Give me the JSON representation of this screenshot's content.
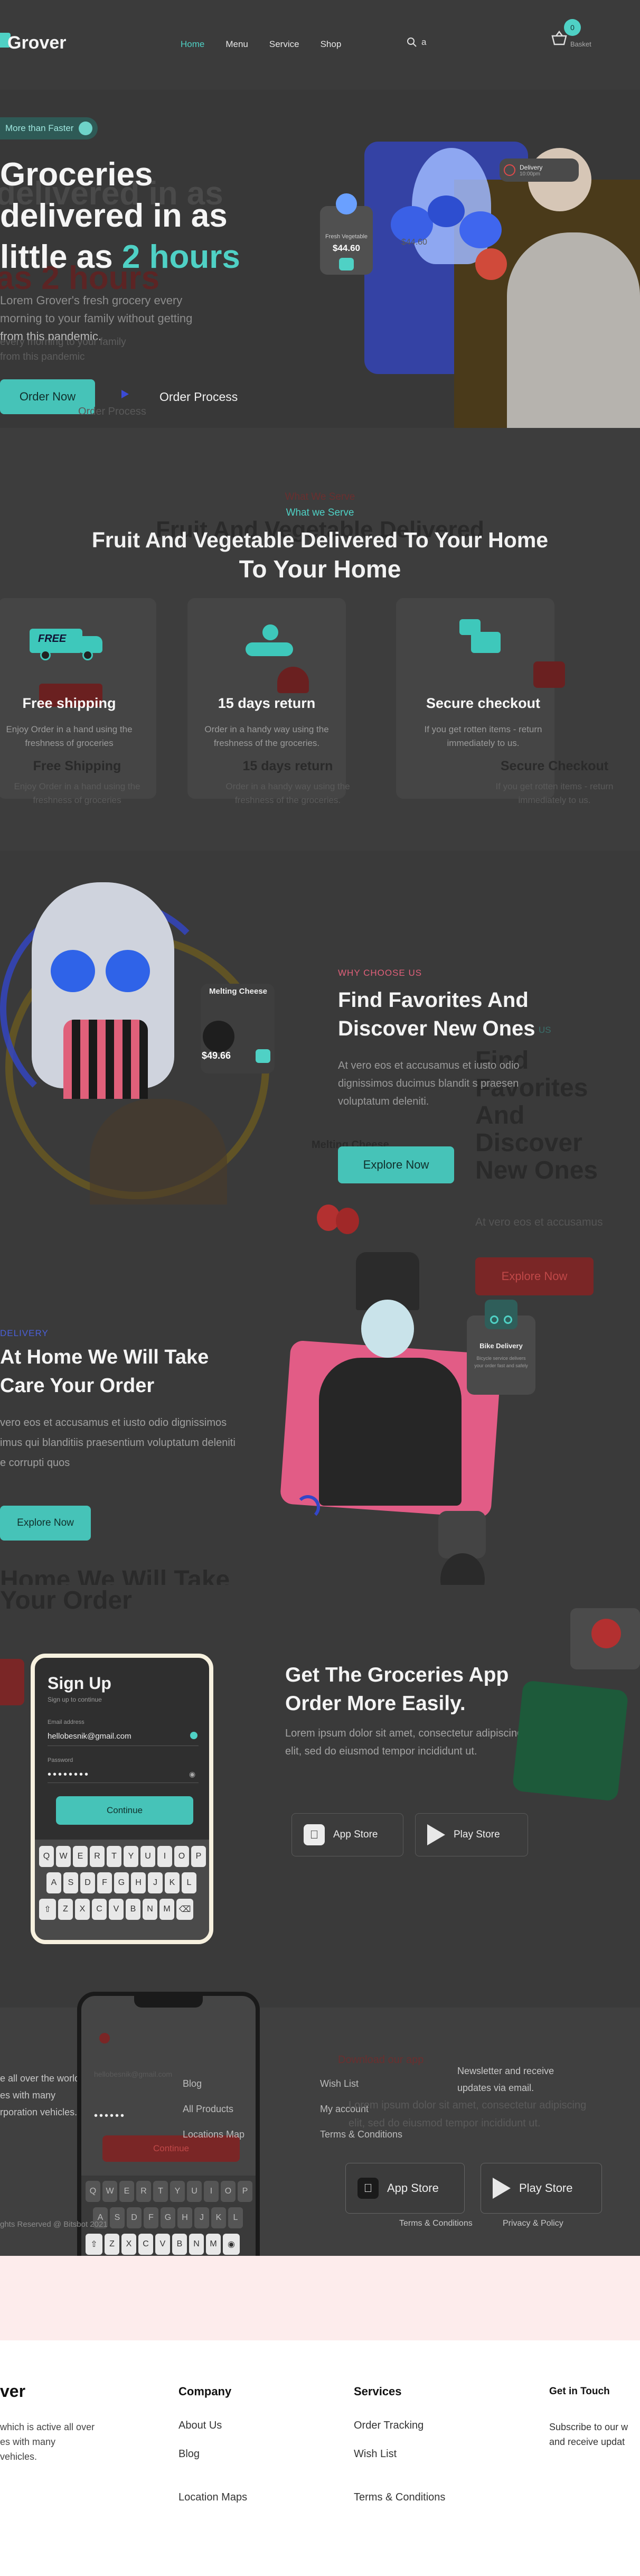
{
  "header": {
    "brand": "Grover",
    "nav": [
      "Home",
      "Menu",
      "Service",
      "Shop"
    ],
    "search_value": "a",
    "cart_count": "0",
    "cart_label": "Basket"
  },
  "hero": {
    "badge": "More than Faster",
    "title_lines": [
      "Groceries",
      "delivered in as",
      "little as"
    ],
    "title_highlight": "2 hours",
    "ghost_line": "as 2 hours",
    "desc_lines": [
      "Lorem Grover's fresh grocery every",
      "morning to your family without getting",
      "from this pandemic."
    ],
    "desc_ghost_lines": [
      "every morning to your family",
      "from this pandemic"
    ],
    "order_now": "Order Now",
    "order_process": "Order Process",
    "order_process_ghost": "Order Process",
    "product_name": "Fresh Vegetable",
    "product_price": "$44.60",
    "delivery_label": "Delivery",
    "delivery_time": "10:00pm",
    "chef_price": "$44.60"
  },
  "serve": {
    "eyebrow_ghost": "What We Serve",
    "eyebrow": "What we Serve",
    "title_ghost": "Fruit And Vegetable Delivered",
    "title_line1": "Fruit And Vegetable Delivered To Your Home",
    "title_line2": "To Your Home",
    "cards": [
      {
        "title": "Free shipping",
        "text": [
          "Enjoy Order in a hand using the",
          "freshness of groceries"
        ],
        "ghost_title": "Free Shipping",
        "ghost_text": [
          "Enjoy Order in a hand using the",
          "freshness of groceries"
        ],
        "free": "FREE"
      },
      {
        "title": "15 days return",
        "text": [
          "Order in a handy way using the",
          "freshness of the groceries."
        ],
        "ghost_title": "15 days return",
        "ghost_text": [
          "Order in a handy way using the",
          "freshness of the groceries."
        ]
      },
      {
        "title": "Secure checkout",
        "text": [
          "If you get rotten items - return",
          "immediately to us."
        ],
        "ghost_title": "Secure Checkout",
        "ghost_text": [
          "If you get rotten items - return",
          "immediately to us."
        ]
      }
    ]
  },
  "fav": {
    "eyebrow": "WHY CHOOSE US",
    "eyebrow_ghost": "US",
    "title_lines": [
      "Find Favorites And",
      "Discover New Ones"
    ],
    "title_ghost_lines": [
      "Find",
      "Favorites",
      "And",
      "Discover",
      "New Ones"
    ],
    "desc_lines": [
      "At vero eos et accusamus et iusto odio",
      "dignissimos ducimus blandit s praesen",
      "voluptatum deleniti."
    ],
    "desc_ghost": "At vero eos et accusamus",
    "explore_now": "Explore Now",
    "explore_ghost": "Explore Now",
    "cheese_name": "Melting Cheese",
    "cheese_ghost": "Melting Cheese",
    "cheese_price": "$49.66",
    "delivery_eyebrow": "DELIVERY",
    "delivery_title_lines": [
      "At Home We Will Take",
      "Care Your Order"
    ],
    "delivery_desc_lines": [
      "vero eos et accusamus et iusto odio dignissimos",
      "imus qui blanditiis praesentium voluptatum deleniti",
      "e corrupti quos"
    ],
    "delivery_explore": "Explore Now",
    "delivery_ghost_lines": [
      "Home We Will Take",
      "Your Order"
    ],
    "bike_title": "Bike Delivery",
    "bike_text": "Bicycle service delivers your order fast and safely"
  },
  "app": {
    "title_lines": [
      "Get The Groceries App",
      "Order More Easily."
    ],
    "desc_lines": [
      "Lorem ipsum dolor sit amet, consectetur adipiscing",
      "elit, sed do eiusmod tempor incididunt ut."
    ],
    "app_store": "App Store",
    "play_store": "Play Store",
    "signup_title": "Sign Up",
    "signup_sub": "Sign up to continue",
    "email_label": "Email address",
    "email_value": "hellobesnik@gmail.com",
    "password_label": "Password",
    "continue": "Continue",
    "keys_row1": [
      "Q",
      "W",
      "E",
      "R",
      "T",
      "Y",
      "U",
      "I",
      "O",
      "P"
    ],
    "keys_row2": [
      "A",
      "S",
      "D",
      "F",
      "G",
      "H",
      "J",
      "K",
      "L"
    ],
    "keys_row3": [
      "Z",
      "X",
      "C",
      "V",
      "B",
      "N",
      "M"
    ]
  },
  "footer_dark": {
    "about_lines": [
      "e all over the world,",
      "es with many",
      "rporation vehicles."
    ],
    "links1": [
      "Blog",
      "All Products",
      "Locations Map"
    ],
    "links2": [
      "Wish List",
      "My account",
      "Terms & Conditions"
    ],
    "download_label": "Download our app",
    "newsletter_lines": [
      "Newsletter and receive",
      "updates via email."
    ],
    "app_desc_lines": [
      "Lorem ipsum dolor sit amet, consectetur adipiscing",
      "elit, sed do eiusmod tempor incididunt ut."
    ],
    "app_store": "App Store",
    "play_store": "Play Store",
    "copyright": "ghts Reserved @ Bitsbot 2021",
    "terms": "Terms & Conditions",
    "privacy": "Privacy & Policy",
    "phone_email": "hellobesnik@gmail.com",
    "phone_continue": "Continue",
    "keys_row1": [
      "Q",
      "W",
      "E",
      "R",
      "T",
      "Y",
      "U",
      "I",
      "O",
      "P"
    ],
    "keys_row2": [
      "A",
      "S",
      "D",
      "F",
      "G",
      "H",
      "J",
      "K",
      "L"
    ],
    "keys_row3": [
      "Z",
      "X",
      "C",
      "V",
      "B",
      "N",
      "M"
    ]
  },
  "footer_light": {
    "brand": "ver",
    "about_lines": [
      "which is active all over",
      "es with many",
      "vehicles."
    ],
    "company_title": "Company",
    "company_links": [
      "About Us",
      "Blog",
      "Location Maps"
    ],
    "services_title": "Services",
    "services_links": [
      "Order Tracking",
      "Wish List",
      "Terms & Conditions"
    ],
    "touch_title": "Get in Touch",
    "touch_lines": [
      "Subscribe to our w",
      "and receive updat"
    ]
  }
}
